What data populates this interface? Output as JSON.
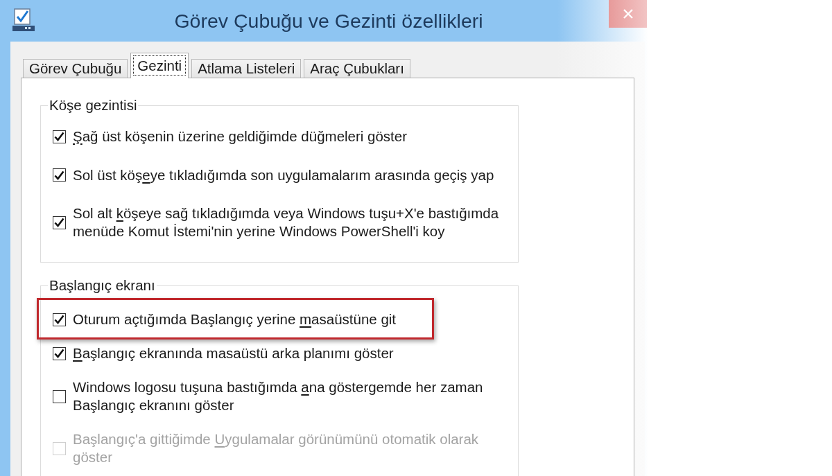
{
  "window": {
    "title": "Görev Çubuğu ve Gezinti özellikleri"
  },
  "tabs": [
    {
      "label": "Görev Çubuğu",
      "selected": false
    },
    {
      "label": "Gezinti",
      "selected": true
    },
    {
      "label": "Atlama Listeleri",
      "selected": false
    },
    {
      "label": "Araç Çubukları",
      "selected": false
    }
  ],
  "groups": [
    {
      "title": "Köşe gezintisi",
      "items": [
        {
          "access_key": "Ş",
          "label_after": "ağ üst köşenin üzerine geldiğimde düğmeleri göster",
          "checked": true,
          "disabled": false,
          "highlighted": false
        },
        {
          "label_before": "Sol üst köş",
          "access_key": "e",
          "label_after": "ye tıkladığımda son uygulamalarım arasında geçiş yap",
          "checked": true,
          "disabled": false,
          "highlighted": false
        },
        {
          "label_before": "Sol alt ",
          "access_key": "k",
          "label_after": "öşeye sağ tıkladığımda veya Windows tuşu+X'e bastığımda menüde Komut İstemi'nin yerine Windows PowerShell'i koy",
          "checked": true,
          "disabled": false,
          "highlighted": false
        }
      ]
    },
    {
      "title": "Başlangıç ekranı",
      "items": [
        {
          "label_before": "Oturum açtığımda Başlangıç yerine ",
          "access_key": "m",
          "label_after": "asaüstüne git",
          "checked": true,
          "disabled": false,
          "highlighted": true
        },
        {
          "access_key": "B",
          "label_after": "aşlangıç ekranında masaüstü arka planımı göster",
          "checked": true,
          "disabled": false,
          "highlighted": false
        },
        {
          "label_before": "Windows logosu tuşuna bastığımda ",
          "access_key": "a",
          "label_after": "na göstergemde her zaman Başlangıç ekranını göster",
          "checked": false,
          "disabled": false,
          "highlighted": false
        },
        {
          "label_before": "Başlangıç'a gittiğimde ",
          "access_key": "U",
          "label_after": "ygulamalar görünümünü otomatik olarak göster",
          "checked": false,
          "disabled": true,
          "highlighted": false
        }
      ]
    }
  ]
}
